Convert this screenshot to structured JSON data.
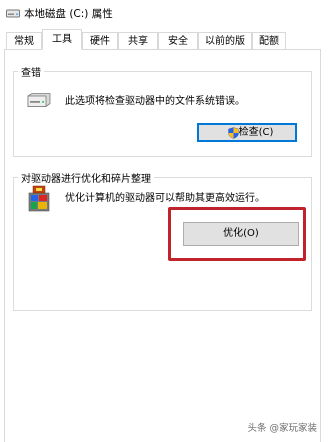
{
  "window": {
    "title": "本地磁盘 (C:) 属性"
  },
  "tabs": [
    {
      "label": "常规",
      "active": false
    },
    {
      "label": "工具",
      "active": true
    },
    {
      "label": "硬件",
      "active": false
    },
    {
      "label": "共享",
      "active": false
    },
    {
      "label": "安全",
      "active": false
    },
    {
      "label": "以前的版本",
      "active": false
    },
    {
      "label": "配额",
      "active": false
    }
  ],
  "error_check": {
    "group_title": "查错",
    "description": "此选项将检查驱动器中的文件系统错误。",
    "button_label": "检查(C)",
    "icon": "drive-icon"
  },
  "optimize": {
    "group_title": "对驱动器进行优化和碎片整理",
    "description": "优化计算机的驱动器可以帮助其更高效运行。",
    "button_label": "优化(O)",
    "icon": "defrag-icon"
  },
  "annotation": {
    "highlight_color": "#c0232b"
  },
  "watermark": {
    "text": "头条 @家玩家装"
  }
}
